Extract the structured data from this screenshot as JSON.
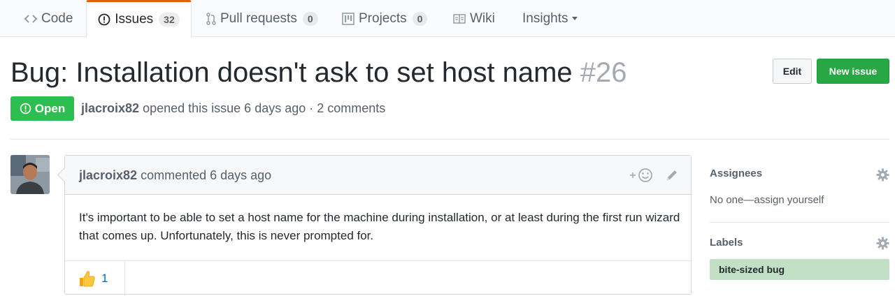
{
  "tabs": [
    {
      "label": "Code",
      "icon": "code-icon"
    },
    {
      "label": "Issues",
      "icon": "issue-opened-icon",
      "count": "32",
      "selected": true
    },
    {
      "label": "Pull requests",
      "icon": "git-pull-request-icon",
      "count": "0"
    },
    {
      "label": "Projects",
      "icon": "project-icon",
      "count": "0"
    },
    {
      "label": "Wiki",
      "icon": "book-icon"
    },
    {
      "label": "Insights",
      "icon": "chevron-down-icon"
    }
  ],
  "issue": {
    "title": "Bug: Installation doesn't ask to set host name",
    "number": "#26",
    "state": "Open",
    "author": "jlacroix82",
    "meta_text": "opened this issue 6 days ago · 2 comments"
  },
  "buttons": {
    "edit": "Edit",
    "new_issue": "New issue"
  },
  "comment": {
    "author": "jlacroix82",
    "action": "commented 6 days ago",
    "body": "It's important to be able to set a host name for the machine during installation, or at least during the first run wizard that comes up. Unfortunately, this is never prompted for.",
    "reaction_count": "1"
  },
  "sidebar": {
    "assignees_heading": "Assignees",
    "assignees_text": "No one—assign yourself",
    "labels_heading": "Labels",
    "label": "bite-sized bug",
    "label_color": "#c2e0c6"
  },
  "colors": {
    "accent_tab": "#e36209",
    "open_state": "#2cbe4e",
    "new_issue": "#28a745"
  }
}
